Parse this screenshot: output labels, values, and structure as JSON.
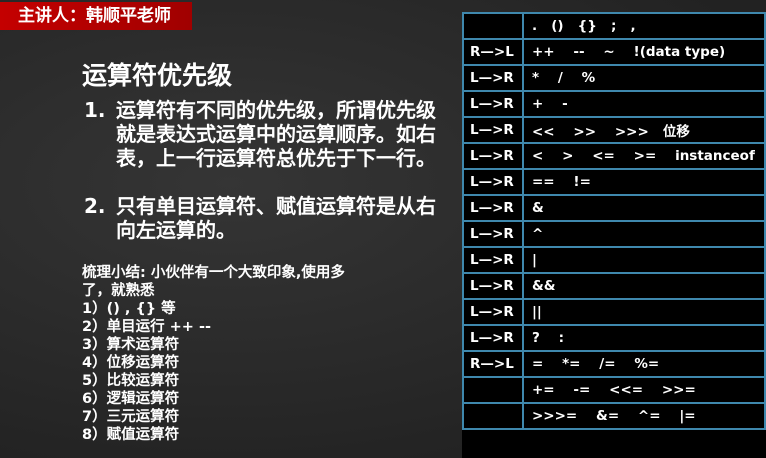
{
  "banner": "主讲人：韩顺平老师",
  "title": "运算符优先级",
  "points": [
    {
      "n": "1.",
      "text": "运算符有不同的优先级，所谓优先级就是表达式运算中的运算顺序。如右表，上一行运算符总优先于下一行。"
    },
    {
      "n": "2.",
      "text": "只有单目运算符、赋值运算符是从右向左运算的。"
    }
  ],
  "summary": [
    "梳理小结: 小伙伴有一个大致印象,使用多了，就熟悉",
    "1）() , {} 等",
    "2）单目运行 ++ --",
    "3）算术运算符",
    "4）位移运算符",
    "5）比较运算符",
    "6）逻辑运算符",
    "7）三元运算符",
    "8）赋值运算符"
  ],
  "table": [
    [
      "",
      ".   ()   {}   ;   ,"
    ],
    [
      "R—>L",
      "++    --    ~    !(data type)"
    ],
    [
      "L—>R",
      "*    /    %"
    ],
    [
      "L—>R",
      "+    -"
    ],
    [
      "L—>R",
      "<<    >>    >>>   位移"
    ],
    [
      "L—>R",
      "<    >    <=    >=    instanceof"
    ],
    [
      "L—>R",
      "==    !="
    ],
    [
      "L—>R",
      "&"
    ],
    [
      "L—>R",
      "^"
    ],
    [
      "L—>R",
      "|"
    ],
    [
      "L—>R",
      "&&"
    ],
    [
      "L—>R",
      "||"
    ],
    [
      "L—>R",
      "?    :"
    ],
    [
      "R—>L",
      "=    *=    /=    %="
    ],
    [
      "",
      "+=    -=    <<=    >>="
    ],
    [
      "",
      ">>>=    &=    ^=    |="
    ]
  ]
}
